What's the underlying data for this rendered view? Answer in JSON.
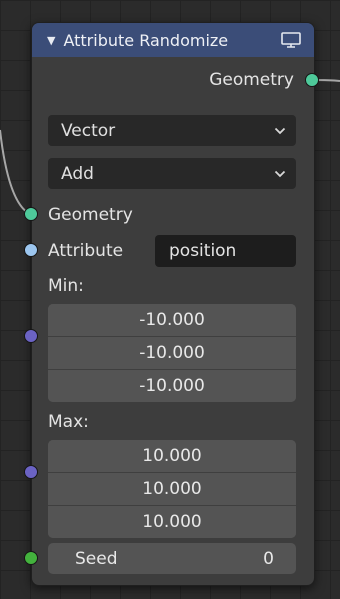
{
  "colors": {
    "header": "#3b4d78",
    "node_body": "#3d3d3d",
    "geometry_socket": "#4ec99a",
    "attribute_socket": "#9cc6ef",
    "vector_socket": "#6b63c4",
    "integer_socket": "#43b23d",
    "wire": "#a7a7a7"
  },
  "node": {
    "title": "Attribute Randomize",
    "collapse_icon": "triangle-down-icon",
    "preview_icon": "monitor-icon"
  },
  "outputs": {
    "geometry_label": "Geometry"
  },
  "data_type": {
    "selected": "Vector",
    "icon": "chevron-down-icon"
  },
  "operation": {
    "selected": "Add",
    "icon": "chevron-down-icon"
  },
  "inputs": {
    "geometry_label": "Geometry",
    "attribute_label": "Attribute",
    "attribute_value": "position",
    "min_label": "Min:",
    "min_values": [
      "-10.000",
      "-10.000",
      "-10.000"
    ],
    "max_label": "Max:",
    "max_values": [
      "10.000",
      "10.000",
      "10.000"
    ],
    "seed_label": "Seed",
    "seed_value": "0"
  }
}
